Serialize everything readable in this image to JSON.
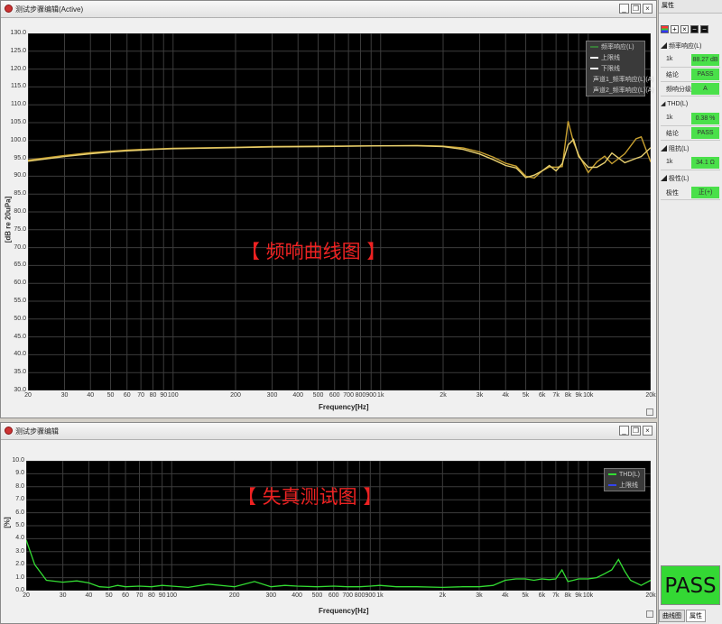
{
  "fr_window": {
    "title": "测试步骤编辑(Active)",
    "overlay_text": "【 频响曲线图 】",
    "ylabel": "[dB re 20uPa]",
    "xlabel": "Frequency[Hz]",
    "y_ticks": [
      "130.0",
      "125.0",
      "120.0",
      "115.0",
      "110.0",
      "105.0",
      "100.0",
      "95.0",
      "90.0",
      "85.0",
      "80.0",
      "75.0",
      "70.0",
      "65.0",
      "60.0",
      "55.0",
      "50.0",
      "45.0",
      "40.0",
      "35.0",
      "30.0"
    ],
    "x_ticks": [
      "20",
      "30",
      "40",
      "50",
      "60",
      "70",
      "80",
      "90",
      "100",
      "200",
      "300",
      "400",
      "500",
      "600",
      "700",
      "800",
      "900",
      "1k",
      "2k",
      "3k",
      "4k",
      "5k",
      "6k",
      "7k",
      "8k",
      "9k",
      "10k",
      "20k"
    ],
    "legend": [
      {
        "label": "频率响应(L)",
        "color": "#3a7d3a"
      },
      {
        "label": "上限线",
        "color": "#ffffff"
      },
      {
        "label": "下限线",
        "color": "#ffffff"
      },
      {
        "label": "声道1_频率响应(L)(A)",
        "color": "#c8a030"
      },
      {
        "label": "声道2_频率响应(L)(A)",
        "color": "#e8d070"
      }
    ]
  },
  "thd_window": {
    "title": "测试步骤编辑",
    "overlay_text": "【 失真测试图 】",
    "ylabel": "[%]",
    "xlabel": "Frequency[Hz]",
    "y_ticks": [
      "10.0",
      "9.0",
      "8.0",
      "7.0",
      "6.0",
      "5.0",
      "4.0",
      "3.0",
      "2.0",
      "1.0",
      "0.0"
    ],
    "x_ticks": [
      "20",
      "30",
      "40",
      "50",
      "60",
      "70",
      "80",
      "90",
      "100",
      "200",
      "300",
      "400",
      "500",
      "600",
      "700",
      "800",
      "900",
      "1k",
      "2k",
      "3k",
      "4k",
      "5k",
      "6k",
      "7k",
      "8k",
      "9k",
      "10k",
      "20k"
    ],
    "legend": [
      {
        "label": "THD(L)",
        "color": "#33dd33"
      },
      {
        "label": "上限线",
        "color": "#3344ee"
      }
    ]
  },
  "right_panel": {
    "title": "属性",
    "tools": [
      "+",
      "×",
      "⬛",
      "⬛"
    ],
    "groups": [
      {
        "name": "频率响应(L)",
        "rows": [
          {
            "key": "1k",
            "value": "88.27 dB"
          },
          {
            "key": "结论",
            "value": "PASS"
          },
          {
            "key": "频响分级",
            "value": "A"
          }
        ]
      },
      {
        "name": "THD(L)",
        "rows": [
          {
            "key": "1k",
            "value": "0.38 %"
          },
          {
            "key": "结论",
            "value": "PASS"
          }
        ]
      },
      {
        "name": "阻抗(L)",
        "rows": [
          {
            "key": "1k",
            "value": "34.1 Ω"
          }
        ]
      },
      {
        "name": "极性(L)",
        "rows": [
          {
            "key": "极性",
            "value": "正(+)"
          }
        ]
      }
    ],
    "result": "PASS",
    "tabs": [
      "曲线图",
      "属性"
    ]
  },
  "chart_data": [
    {
      "type": "line",
      "title": "",
      "xlabel": "Frequency[Hz]",
      "ylabel": "[dB re 20uPa]",
      "xscale": "log",
      "xlim": [
        20,
        20000
      ],
      "ylim": [
        30,
        130
      ],
      "grid": true,
      "legend_position": "top-right",
      "series": [
        {
          "name": "声道1_频率响应(L)(A)",
          "color": "#c8a030",
          "x": [
            20,
            30,
            40,
            50,
            60,
            70,
            80,
            100,
            200,
            300,
            500,
            1000,
            1500,
            2000,
            2500,
            3000,
            3500,
            4000,
            4500,
            5000,
            5500,
            6000,
            6500,
            7000,
            7500,
            8000,
            8500,
            9000,
            10000,
            11000,
            12000,
            13000,
            15000,
            17000,
            18000,
            20000
          ],
          "y": [
            94.5,
            95.8,
            96.6,
            97,
            97.3,
            97.5,
            97.6,
            97.8,
            98.1,
            98.3,
            98.4,
            98.5,
            98.6,
            98.4,
            97.9,
            96.8,
            95.3,
            93.6,
            92.8,
            90,
            89.5,
            91.5,
            92.6,
            92.5,
            92.7,
            105.4,
            99.5,
            96,
            91,
            94,
            95.6,
            93.5,
            96.3,
            100.5,
            101,
            94
          ]
        },
        {
          "name": "声道2_频率响应(L)(A)",
          "color": "#e8d070",
          "x": [
            20,
            30,
            40,
            50,
            60,
            70,
            80,
            100,
            200,
            300,
            500,
            1000,
            1500,
            2000,
            2500,
            3000,
            3500,
            4000,
            4500,
            5000,
            5500,
            6000,
            6500,
            7000,
            7500,
            8000,
            8500,
            9000,
            10000,
            11000,
            12000,
            13000,
            15000,
            17000,
            18000,
            20000
          ],
          "y": [
            94.2,
            95.5,
            96.3,
            96.8,
            97.1,
            97.3,
            97.5,
            97.7,
            98,
            98.2,
            98.3,
            98.5,
            98.5,
            98.3,
            97.5,
            96.2,
            94.6,
            93,
            92.3,
            89.6,
            90.3,
            91.5,
            93,
            91.5,
            93.5,
            98.8,
            100.3,
            95.5,
            92.5,
            92.5,
            93.8,
            96.5,
            93.8,
            95,
            95.5,
            98
          ]
        }
      ]
    },
    {
      "type": "line",
      "title": "",
      "xlabel": "Frequency[Hz]",
      "ylabel": "[%]",
      "xscale": "log",
      "xlim": [
        20,
        20000
      ],
      "ylim": [
        0,
        10
      ],
      "grid": true,
      "legend_position": "top-right",
      "series": [
        {
          "name": "THD(L)",
          "color": "#33dd33",
          "x": [
            20,
            22,
            25,
            30,
            35,
            40,
            45,
            50,
            55,
            60,
            70,
            80,
            90,
            100,
            120,
            150,
            200,
            250,
            300,
            350,
            400,
            500,
            600,
            700,
            800,
            900,
            1000,
            1200,
            1500,
            2000,
            2500,
            3000,
            3500,
            4000,
            4500,
            5000,
            5500,
            6000,
            6500,
            7000,
            7500,
            8000,
            8500,
            9000,
            10000,
            11000,
            12000,
            13000,
            14000,
            15000,
            16000,
            17000,
            18000,
            20000
          ],
          "y": [
            3.9,
            2.0,
            0.8,
            0.65,
            0.75,
            0.6,
            0.3,
            0.25,
            0.4,
            0.3,
            0.35,
            0.3,
            0.4,
            0.35,
            0.25,
            0.5,
            0.3,
            0.7,
            0.3,
            0.4,
            0.35,
            0.3,
            0.35,
            0.3,
            0.3,
            0.35,
            0.4,
            0.3,
            0.3,
            0.25,
            0.3,
            0.3,
            0.4,
            0.8,
            0.9,
            0.9,
            0.8,
            0.9,
            0.85,
            0.9,
            1.6,
            0.7,
            0.8,
            0.9,
            0.9,
            1.0,
            1.3,
            1.6,
            2.4,
            1.5,
            0.8,
            0.6,
            0.4,
            0.8
          ]
        },
        {
          "name": "上限线",
          "color": "#3344ee",
          "x": [],
          "y": []
        }
      ]
    }
  ]
}
